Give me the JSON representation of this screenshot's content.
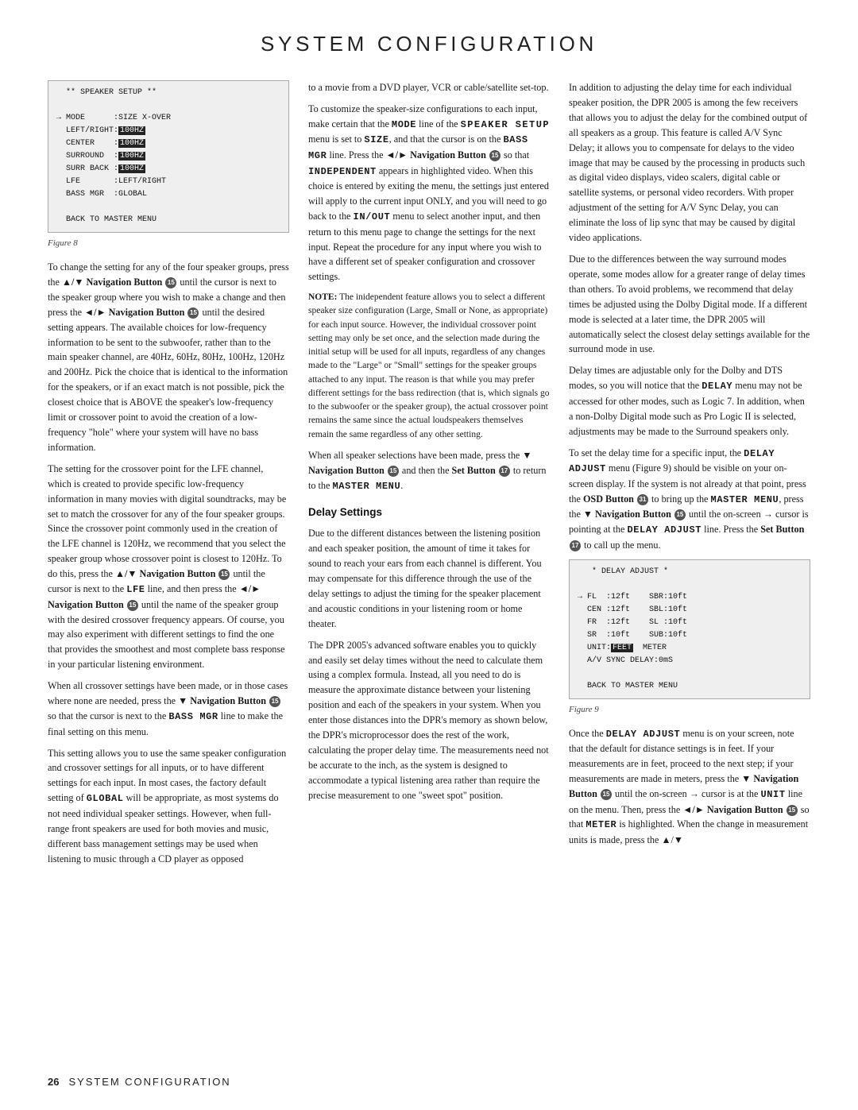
{
  "header": {
    "title": "SYSTEM CONFIGURATION"
  },
  "footer": {
    "page_number": "26",
    "text": "SYSTEM CONFIGURATION"
  },
  "col1": {
    "figure1": {
      "caption": "Figure 8",
      "lines": [
        "  ** SPEAKER SETUP **",
        "",
        "→ MODE      :SIZE X-OVER",
        "  LEFT/RIGHT:100HZ",
        "  CENTER    :100HZ",
        "  SURROUND  :100HZ",
        "  SURR BACK :100HZ",
        "  LFE       :LEFT/RIGHT",
        "  BASS MGR  :GLOBAL",
        "",
        "  BACK TO MASTER MENU"
      ]
    },
    "paragraphs": [
      "To change the setting for any of the four speaker groups, press the ▲/▼ Navigation Button 15 until the cursor is next to the speaker group where you wish to make a change and then press the ◄/► Navigation Button 15 until the desired setting appears. The available choices for low-frequency information to be sent to the subwoofer, rather than to the main speaker channel, are 40Hz, 60Hz, 80Hz, 100Hz, 120Hz and 200Hz. Pick the choice that is identical to the information for the speakers, or if an exact match is not possible, pick the closest choice that is ABOVE the speaker's low-frequency limit or crossover point to avoid the creation of a low-frequency \"hole\" where your system will have no bass information.",
      "The setting for the crossover point for the LFE channel, which is created to provide specific low-frequency information in many movies with digital soundtracks, may be set to match the crossover for any of the four speaker groups. Since the crossover point commonly used in the creation of the LFE channel is 120Hz, we recommend that you select the speaker group whose crossover point is closest to 120Hz. To do this, press the ▲/▼ Navigation Button 15 until the cursor is next to the LFE line, and then press the ◄/► Navigation Button 15 until the name of the speaker group with the desired crossover frequency appears. Of course, you may also experiment with different settings to find the one that provides the smoothest and most complete bass response in your particular listening environment.",
      "When all crossover settings have been made, or in those cases where none are needed, press the ▼ Navigation Button 15 so that the cursor is next to the BASS MGR line to make the final setting on this menu.",
      "This setting allows you to use the same speaker configuration and crossover settings for all inputs, or to have different settings for each input. In most cases, the factory default setting of GLOBAL will be appropriate, as most systems do not need individual speaker settings. However, when full-range front speakers are used for both movies and music, different bass management settings may be used when listening to music through a CD player as opposed"
    ]
  },
  "col2": {
    "intro": "to a movie from a DVD player, VCR or cable/satellite set-top.",
    "para1": "To customize the speaker-size configurations to each input, make certain that the MODE line of the SPEAKER SETUP menu is set to SIZE, and that the cursor is on the BASS MGR line. Press the ◄/► Navigation Button 15 so that INDEPENDENT appears in highlighted video. When this choice is entered by exiting the menu, the settings just entered will apply to the current input ONLY, and you will need to go back to the IN/OUT menu to select another input, and then return to this menu page to change the settings for the next input. Repeat the procedure for any input where you wish to have a different set of speaker configuration and crossover settings.",
    "note": "NOTE: The inidependent feature allows you to select a different speaker size configuration (Large, Small or None, as appropriate) for each input source. However, the individual crossover point setting may only be set once, and the selection made during the initial setup will be used for all inputs, regardless of any changes made to the \"Large\" or \"Small\" settings for the speaker groups attached to any input. The reason is that while you may prefer different settings for the bass redirection (that is, which signals go to the subwoofer or the speaker group), the actual crossover point remains the same since the actual loudspeakers themselves remain the same regardless of any other setting.",
    "para2": "When all speaker selections have been made, press the ▼ Navigation Button 15 and then the Set Button 17 to return to the MASTER MENU.",
    "delay_heading": "Delay Settings",
    "delay_para1": "Due to the different distances between the listening position and each speaker position, the amount of time it takes for sound to reach your ears from each channel is different. You may compensate for this difference through the use of the delay settings to adjust the timing for the speaker placement and acoustic conditions in your listening room or home theater.",
    "delay_para2": "The DPR 2005's advanced software enables you to quickly and easily set delay times without the need to calculate them using a complex formula. Instead, all you need to do is measure the approximate distance between your listening position and each of the speakers in your system. When you enter those distances into the DPR's memory as shown below, the DPR's microprocessor does the rest of the work, calculating the proper delay time. The measurements need not be accurate to the inch, as the system is designed to accommodate a typical listening area rather than require the precise measurement to one \"sweet spot\" position."
  },
  "col3": {
    "para1": "In addition to adjusting the delay time for each individual speaker position, the DPR 2005 is among the few receivers that allows you to adjust the delay for the combined output of all speakers as a group. This feature is called A/V Sync Delay; it allows you to compensate for delays to the video image that may be caused by the processing in products such as digital video displays, video scalers, digital cable or satellite systems, or personal video recorders. With proper adjustment of the setting for A/V Sync Delay, you can eliminate the loss of lip sync that may be caused by digital video applications.",
    "para2": "Due to the differences between the way surround modes operate, some modes allow for a greater range of delay times than others. To avoid problems, we recommend that delay times be adjusted using the Dolby Digital mode. If a different mode is selected at a later time, the DPR 2005 will automatically select the closest delay settings available for the surround mode in use.",
    "para3": "Delay times are adjustable only for the Dolby and DTS modes, so you will notice that the DELAY menu may not be accessed for other modes, such as Logic 7. In addition, when a non-Dolby Digital mode such as Pro Logic II is selected, adjustments may be made to the Surround speakers only.",
    "para4": "To set the delay time for a specific input, the DELAY ADJUST menu (Figure 9) should be visible on your on-screen display. If the system is not already at that point, press the OSD Button 31 to bring up the MASTER MENU, press the ▼ Navigation Button 15 until the on-screen → cursor is pointing at the DELAY ADJUST line. Press the Set Button 17 to call up the menu.",
    "figure2": {
      "caption": "Figure 9",
      "lines": [
        "   * DELAY ADJUST *",
        "",
        "→ FL  :12ft    SBR:10ft",
        "  CEN :12ft    SBL:10ft",
        "  FR  :12ft    SL :10ft",
        "  SR  :10ft    SUB:10ft",
        "  UNIT:FEET  METER",
        "  A/V SYNC DELAY:0mS",
        "",
        "  BACK TO MASTER MENU"
      ]
    },
    "para5": "Once the DELAY ADJUST menu is on your screen, note that the default for distance settings is in feet. If your measurements are in feet, proceed to the next step; if your measurements are made in meters, press the ▼ Navigation Button 15 until the on-screen → cursor is at the UNIT line on the menu. Then, press the ◄/► Navigation Button 15 so that METER is highlighted. When the change in measurement units is made, press the ▲/▼"
  },
  "icons": {
    "arrow_up_down": "▲/▼",
    "arrow_lr": "◄/►",
    "arrow_right": "→",
    "nav_btn_15": "15",
    "nav_btn_17": "17",
    "nav_btn_31": "31"
  }
}
